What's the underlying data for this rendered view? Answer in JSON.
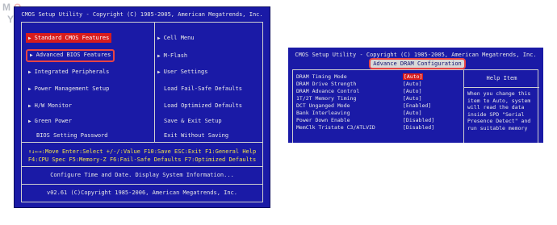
{
  "watermark": {
    "m": "M",
    "o1": "O",
    "y2": "Y",
    "o2": "O"
  },
  "bios1": {
    "title": "CMOS Setup Utility - Copyright (C) 1985-2005, American Megatrends, Inc.",
    "left_menu": [
      "Standard CMOS Features",
      "Advanced BIOS Features",
      "Integrated Peripherals",
      "Power Management Setup",
      "H/W Monitor",
      "Green Power",
      "BIOS Setting Password"
    ],
    "right_menu": [
      "Cell Menu",
      "M-Flash",
      "User Settings",
      "Load Fail-Safe Defaults",
      "Load Optimized Defaults",
      "Save & Exit Setup",
      "Exit Without Saving"
    ],
    "keys_line1": "↑↓←→:Move  Enter:Select  +/-/:Value  F10:Save  ESC:Exit  F1:General Help",
    "keys_line2": "F4:CPU Spec  F5:Memory-Z  F6:Fail-Safe Defaults  F7:Optimized Defaults",
    "status": "Configure Time and Date.  Display System Information...",
    "footer": "v02.61 (C)Copyright 1985-2006, American Megatrends, Inc.",
    "colors": {
      "background": "#1a1aa6",
      "highlight": "#d81c1c",
      "annotation": "#e84444",
      "keys": "#f2e24a"
    }
  },
  "bios2": {
    "title": "CMOS Setup Utility - Copyright (C) 1985-2005, American Megatrends, Inc.",
    "subtitle": "Advance DRAM Configuration",
    "rows": [
      {
        "label": "DRAM Timing Mode",
        "value": "[Auto]"
      },
      {
        "label": "DRAM Drive Strength",
        "value": "[Auto]"
      },
      {
        "label": "DRAM Advance Control",
        "value": "[Auto]"
      },
      {
        "label": "1T/2T Memory Timing",
        "value": "[Auto]"
      },
      {
        "label": "DCT Unganged Mode",
        "value": "[Enabled]"
      },
      {
        "label": "Bank Interleaving",
        "value": "[Auto]"
      },
      {
        "label": "Power Down Enable",
        "value": "[Disabled]"
      },
      {
        "label": "MemClk Tristate C3/ATLVID",
        "value": "[Disabled]"
      }
    ],
    "help_title": "Help Item",
    "help_lines": [
      "When you change this",
      "item to Auto, system",
      "will read the data",
      "inside SPD \"Serial",
      "Presence Detect\" and",
      "run suitable memory"
    ]
  }
}
